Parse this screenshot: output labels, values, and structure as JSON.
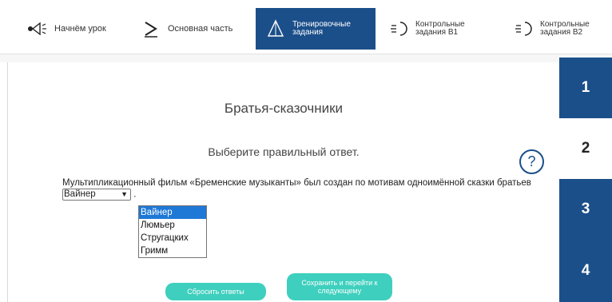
{
  "nav": {
    "tabs": [
      {
        "label": "Начнём урок",
        "icon": "speaker-icon",
        "active": false
      },
      {
        "label": "Основная часть",
        "icon": "play-icon",
        "active": false
      },
      {
        "label": "Тренировочные задания",
        "icon": "triangle-icon",
        "active": true
      },
      {
        "label": "Контрольные задания В1",
        "icon": "circle-arrows-icon",
        "active": false
      },
      {
        "label": "Контрольные задания В2",
        "icon": "circle-arrows-icon",
        "active": false
      }
    ]
  },
  "main": {
    "title": "Братья-сказочники",
    "instruction": "Выберите правильный ответ.",
    "help": "?",
    "question_part1": "Мультипликационный фильм «Бременские музыканты» был создан по мотивам одноимённой сказки братьев",
    "question_end": ".",
    "select": {
      "value": "Вайнер",
      "options": [
        "Вайнер",
        "Люмьер",
        "Стругацких",
        "Гримм"
      ]
    },
    "reset_label": "Сбросить ответы",
    "save_label": "Сохранить и перейти к следующему"
  },
  "tasks": {
    "items": [
      "1",
      "2",
      "3",
      "4"
    ],
    "current": "2"
  },
  "colors": {
    "accent": "#1b4f8a",
    "button": "#3ecfbe",
    "selected_option": "#1e78d6"
  }
}
